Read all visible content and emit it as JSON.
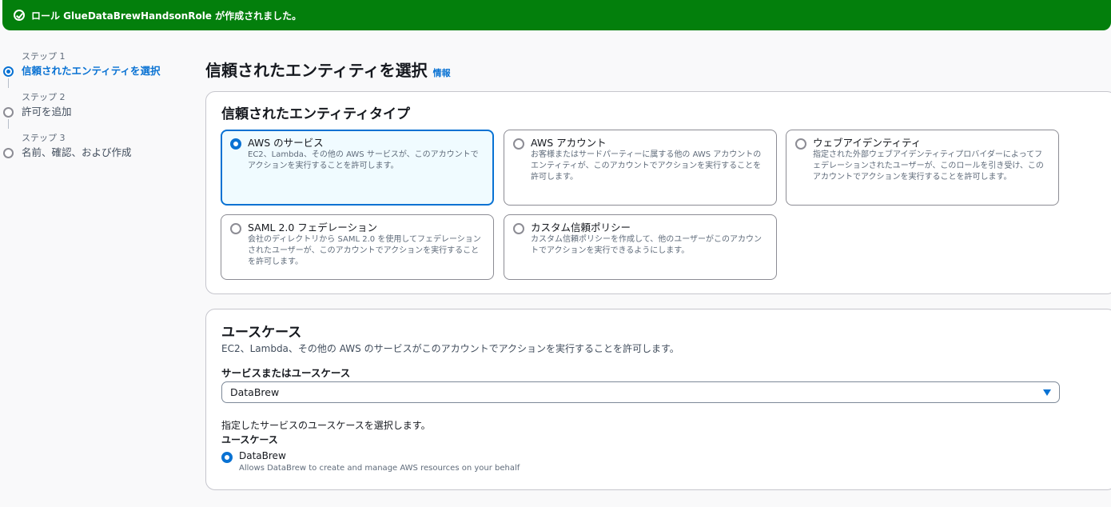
{
  "flash": {
    "message": "ロール GlueDataBrewHandsonRole が作成されました。"
  },
  "steps": [
    {
      "caption": "ステップ 1",
      "label": "信頼されたエンティティを選択"
    },
    {
      "caption": "ステップ 2",
      "label": "許可を追加"
    },
    {
      "caption": "ステップ 3",
      "label": "名前、確認、および作成"
    }
  ],
  "page": {
    "title": "信頼されたエンティティを選択",
    "info": "情報"
  },
  "entity_type": {
    "heading": "信頼されたエンティティタイプ",
    "options": [
      {
        "title": "AWS のサービス",
        "desc": "EC2、Lambda、その他の AWS サービスが、このアカウントでアクションを実行することを許可します。"
      },
      {
        "title": "AWS アカウント",
        "desc": "お客様またはサードパーティーに属する他の AWS アカウントのエンティティが、このアカウントでアクションを実行することを許可します。"
      },
      {
        "title": "ウェブアイデンティティ",
        "desc": "指定された外部ウェブアイデンティティプロバイダーによってフェデレーションされたユーザーが、このロールを引き受け、このアカウントでアクションを実行することを許可します。"
      },
      {
        "title": "SAML 2.0 フェデレーション",
        "desc": "会社のディレクトリから SAML 2.0 を使用してフェデレーションされたユーザーが、このアカウントでアクションを実行することを許可します。"
      },
      {
        "title": "カスタム信頼ポリシー",
        "desc": "カスタム信頼ポリシーを作成して、他のユーザーがこのアカウントでアクションを実行できるようにします。"
      }
    ],
    "selected": "AWS のサービス"
  },
  "use_case": {
    "heading": "ユースケース",
    "description": "EC2、Lambda、その他の AWS のサービスがこのアカウントでアクションを実行することを許可します。",
    "service_label": "サービスまたはユースケース",
    "service_value": "DataBrew",
    "hint": "指定したサービスのユースケースを選択します。",
    "uc_label": "ユースケース",
    "option_title": "DataBrew",
    "option_desc": "Allows DataBrew to create and manage AWS resources on your behalf"
  }
}
